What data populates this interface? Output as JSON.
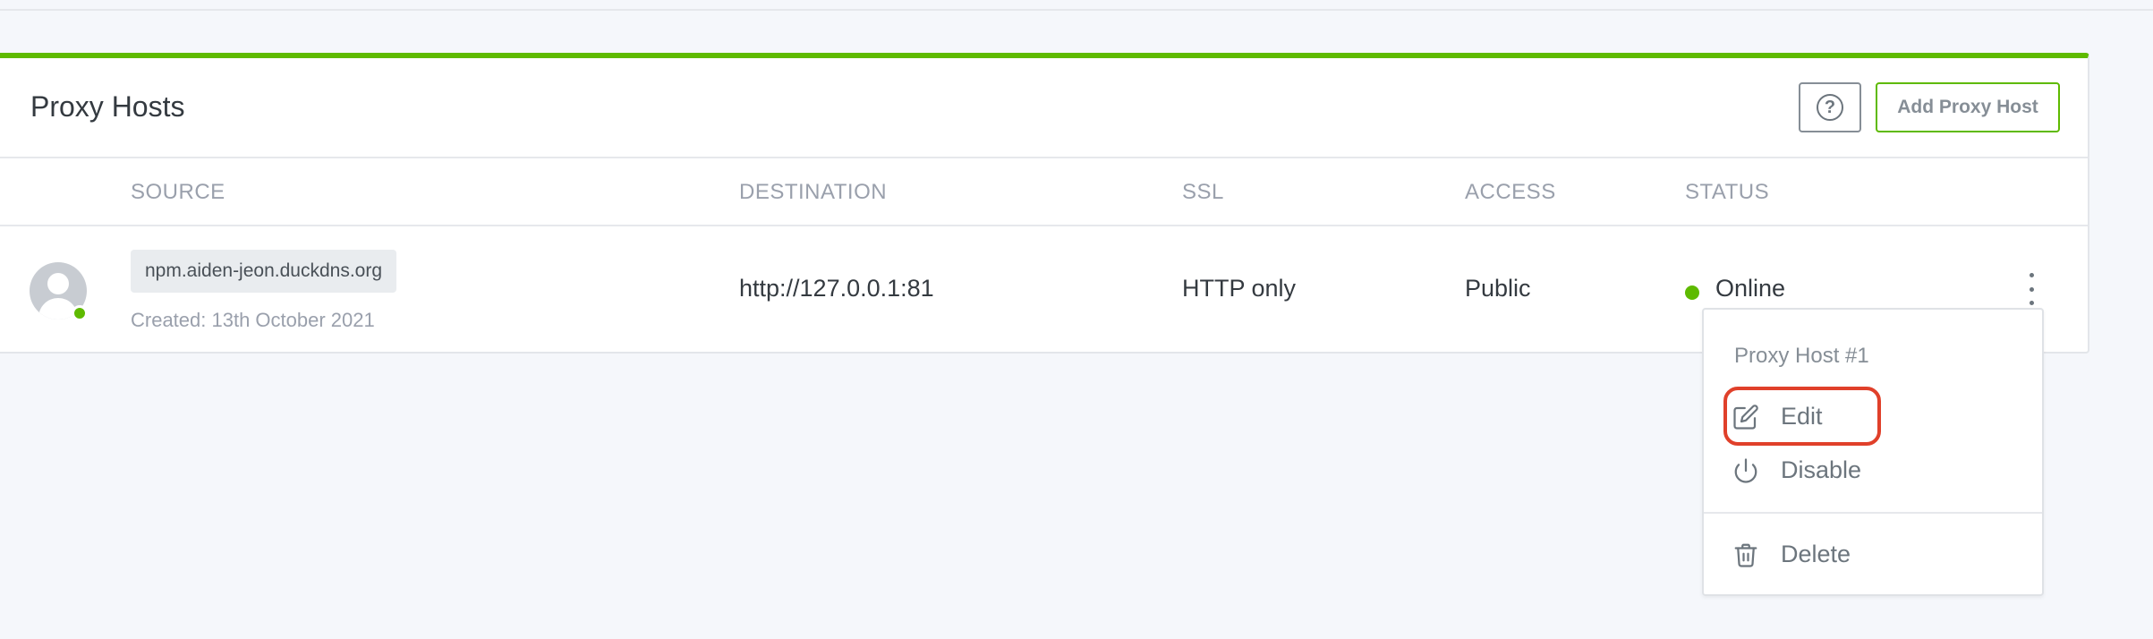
{
  "card": {
    "title": "Proxy Hosts",
    "help_icon_glyph": "?",
    "add_button_label": "Add Proxy Host",
    "accent_color": "#5eba00"
  },
  "table": {
    "columns": [
      "SOURCE",
      "DESTINATION",
      "SSL",
      "ACCESS",
      "STATUS"
    ],
    "rows": [
      {
        "source": "npm.aiden-jeon.duckdns.org",
        "created": "Created: 13th October 2021",
        "destination": "http://127.0.0.1:81",
        "ssl": "HTTP only",
        "access": "Public",
        "status": "Online",
        "status_color": "#5eba00"
      }
    ]
  },
  "context_menu": {
    "header": "Proxy Host #1",
    "items": [
      {
        "label": "Edit",
        "icon": "edit-icon"
      },
      {
        "label": "Disable",
        "icon": "power-icon"
      },
      {
        "label": "Delete",
        "icon": "trash-icon"
      }
    ],
    "highlight_color": "#e0402a"
  }
}
